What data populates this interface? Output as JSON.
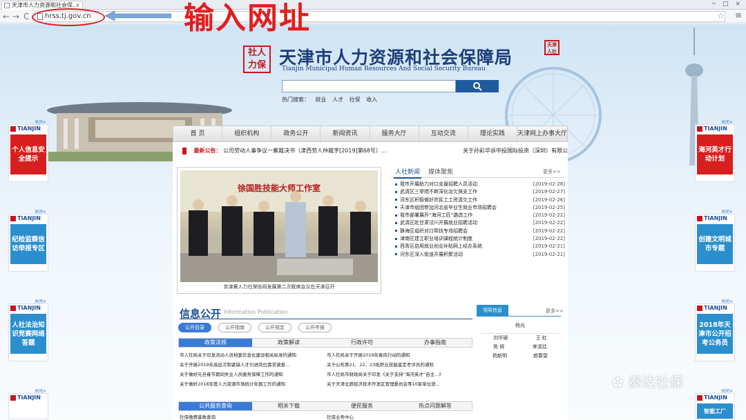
{
  "browser": {
    "tab_title": "天津市人力资源和社会保...",
    "tab_close": "×",
    "url": "hrss.tj.gov.cn",
    "back": "←",
    "forward": "→",
    "reload": "C",
    "window_controls": [
      "─",
      "□",
      "×"
    ]
  },
  "annotation": {
    "text": "输入网址",
    "color": "#e31d1d"
  },
  "header": {
    "seal_text": "社人力保",
    "title": "天津市人力资源和社会保障局",
    "subtitle": "Tianjin Municipal Human Resources And Social Security Bureau",
    "corner_seal": "天津市人社局",
    "search_placeholder": "",
    "search_button_icon": "search-icon",
    "hot_search_label": "热门搜索：",
    "hot_search_terms": [
      "就业",
      "人才",
      "社保",
      "收入"
    ]
  },
  "nav": [
    "首 页",
    "组织机构",
    "政务公开",
    "新闻资讯",
    "服务大厅",
    "互动交流",
    "理论实践",
    "天津网上办事大厅"
  ],
  "notice": {
    "label": "最新公告：",
    "text": "公司劳动人事争议一案裁决书（津西劳人仲裁字[2019]第68号）...",
    "text2": "关于孙彩华诉中投国际投资（深圳）有限公"
  },
  "photo": {
    "banner": "徐国胜技能大师工作室",
    "caption": "京津冀人力社保协同发展第二次联席会议在天津召开"
  },
  "news": {
    "tab_active": "人社新闻",
    "tab_other": "媒体聚焦",
    "more": "更多>>",
    "items": [
      {
        "title": "我市开展助力对口支援招聘人员活动",
        "date": "[2019-02-28]"
      },
      {
        "title": "武清区三举措不断深化治欠保支工作",
        "date": "[2019-02-27]"
      },
      {
        "title": "河东区积极做好农民工工资清欠工作",
        "date": "[2019-02-26]"
      },
      {
        "title": "天津市组团参加河北省毕业生就业市场招聘会",
        "date": "[2019-02-25]"
      },
      {
        "title": "我市部署展开“海河工匠”遴选工作",
        "date": "[2019-02-22]"
      },
      {
        "title": "武清区赴甘肃泾川开展就业招聘活动",
        "date": "[2019-02-22]"
      },
      {
        "title": "静海区组织对口帮扶专场招聘会",
        "date": "[2019-02-22]"
      },
      {
        "title": "津南区建立职业培训课程统计制度",
        "date": "[2019-02-22]"
      },
      {
        "title": "西青区启用就业创业补贴网上经办系统",
        "date": "[2019-02-21]"
      },
      {
        "title": "河东区深入街道开展积聚活动",
        "date": "[2019-02-21]"
      }
    ]
  },
  "info": {
    "title": "信息公开",
    "subtitle": "Information Publication",
    "pills": [
      "公开目录",
      "公开指南",
      "公开规定",
      "公开年报"
    ],
    "subtabs": [
      "政策法规",
      "政策解读",
      "行政许可",
      "办事指南"
    ],
    "rows": [
      [
        "市人社局关于印发流动人员档案信息化建设相关标准的通知",
        "市人社局关于开展2019年春风行动的通知"
      ],
      [
        "关于开展2019年高层次和紧缺人才引进岗位需求调查...",
        "关于公布第21、22、23批职业技能鉴定考评员的通知"
      ],
      [
        "关于做好元旦春节期间失业人员服务保障工作的通知",
        "市人社局市财政局关于印发《关于支持“海河英才”自主...》"
      ],
      [
        "关于做好2018年度人力资源市场统计年报工作的通知",
        "关于天津北辰经济技术开发区管理委员会等10家单位获..."
      ]
    ],
    "subtabs2": [
      "公共服务查询",
      "相关下载",
      "便民服务",
      "热点问题解答"
    ],
    "bottom": [
      "社保缴费基数查询",
      "社保业务中心"
    ]
  },
  "leaders": {
    "tab": "领导信息",
    "more": "更多>>",
    "top": "杨光",
    "rows": [
      [
        "刘华珊",
        "王 虹"
      ],
      [
        "陈 辉",
        "李清廷"
      ],
      [
        "杨新明",
        "郝春雷"
      ]
    ]
  },
  "side_ads": {
    "close": "关闭×",
    "brand": "TIANJIN",
    "left": [
      {
        "text": "个人信息安全提示",
        "style": "red"
      },
      {
        "text": "纪检监察信访举报专区",
        "style": "blue"
      },
      {
        "text": "人社法治知识竞赛网络答题",
        "style": "blue"
      },
      {
        "text": "",
        "style": "blue"
      }
    ],
    "right": [
      {
        "text": "海河英才行动计划",
        "style": "red"
      },
      {
        "text": "创建文明城市专题",
        "style": "blue"
      },
      {
        "text": "2018年天津市公开招考公务员",
        "style": "blue"
      },
      {
        "text": "智能工厂",
        "style": "blue"
      }
    ]
  },
  "watermark": "泰达社保"
}
